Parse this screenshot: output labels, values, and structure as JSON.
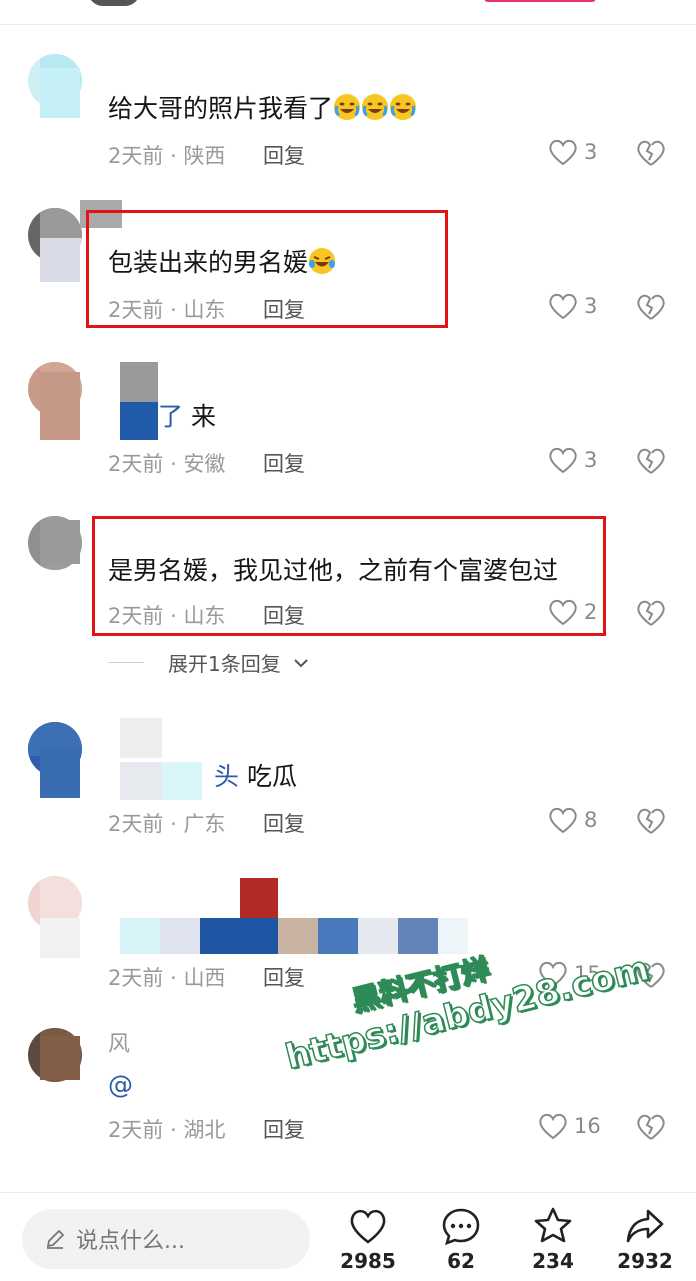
{
  "comments": [
    {
      "text": "给大哥的照片我看了",
      "time": "2天前",
      "location": "陕西",
      "reply": "回复",
      "likes": "3"
    },
    {
      "text": "包装出来的男名媛",
      "time": "2天前",
      "location": "山东",
      "reply": "回复",
      "likes": "3"
    },
    {
      "mention": "了",
      "text": "来",
      "time": "2天前",
      "location": "安徽",
      "reply": "回复",
      "likes": "3"
    },
    {
      "text": "是男名媛，我见过他，之前有个富婆包过",
      "time": "2天前",
      "location": "山东",
      "reply": "回复",
      "likes": "2",
      "expand": "展开1条回复"
    },
    {
      "mention": "头",
      "text": "吃瓜",
      "time": "2天前",
      "location": "广东",
      "reply": "回复",
      "likes": "8"
    },
    {
      "time": "2天前",
      "location": "山西",
      "reply": "回复",
      "likes": "15"
    },
    {
      "name_fragment": "风",
      "mention": "@",
      "time": "2天前",
      "location": "湖北",
      "reply": "回复",
      "likes": "16"
    }
  ],
  "meta_separator": "·",
  "watermark": {
    "line1": "黑料不打烊",
    "line2": "https://abdy28.com"
  },
  "bottom_bar": {
    "input_placeholder": "说点什么...",
    "like_count": "2985",
    "comment_count": "62",
    "favorite_count": "234",
    "share_count": "2932"
  },
  "colors": {
    "highlight_box": "#e01414",
    "mention": "#2d5aa8",
    "watermark_stroke": "#2e8b57"
  }
}
